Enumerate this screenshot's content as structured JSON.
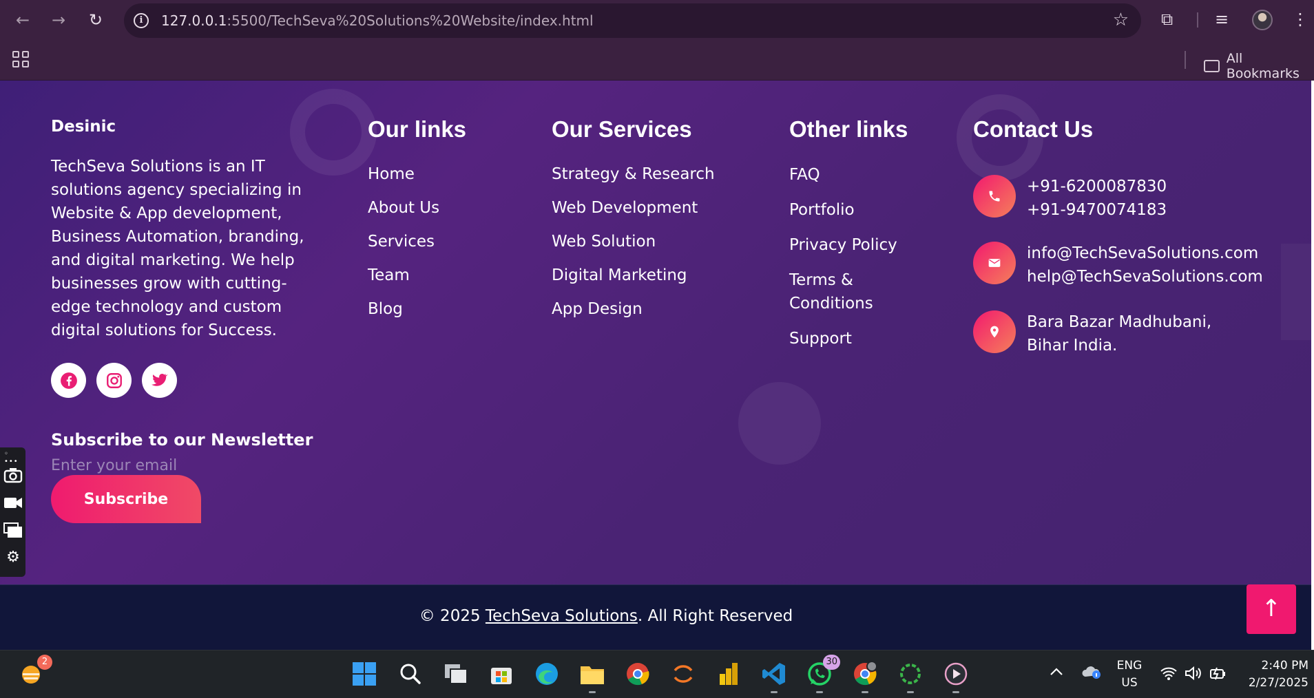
{
  "browser": {
    "url_host": "127.0.0.1",
    "url_rest": ":5500/TechSeva%20Solutions%20Website/index.html",
    "all_bookmarks": "All Bookmarks"
  },
  "footer": {
    "brand": "Desinic",
    "about": "TechSeva Solutions is an IT solutions agency specializing in Website & App development, Business Automation, branding, and digital marketing. We help businesses grow with cutting-edge technology and custom digital solutions for Success.",
    "socials": [
      "facebook",
      "instagram",
      "twitter"
    ],
    "newsletter": {
      "title": "Subscribe to our Newsletter",
      "placeholder": "Enter your email",
      "button": "Subscribe"
    },
    "our_links": {
      "title": "Our links",
      "items": [
        "Home",
        "About Us",
        "Services",
        "Team",
        "Blog"
      ]
    },
    "our_services": {
      "title": "Our Services",
      "items": [
        "Strategy & Research",
        "Web Development",
        "Web Solution",
        "Digital Marketing",
        "App Design"
      ]
    },
    "other_links": {
      "title": "Other links",
      "items": [
        "FAQ",
        "Portfolio",
        "Privacy Policy",
        "Terms & Conditions",
        "Support"
      ]
    },
    "contact": {
      "title": "Contact Us",
      "phone1": "+91-6200087830",
      "phone2": "+91-9470074183",
      "email1": "info@TechSevaSolutions.com",
      "email2": "help@TechSevaSolutions.com",
      "address": "Bara Bazar Madhubani, Bihar India."
    }
  },
  "copyright": {
    "prefix": "© 2025 ",
    "company": "TechSeva Solutions",
    "suffix": ". All Right Reserved"
  },
  "taskbar": {
    "weather_badge": "2",
    "whatsapp_badge": "30",
    "lang_line1": "ENG",
    "lang_line2": "US",
    "time": "2:40 PM",
    "date": "2/27/2025"
  },
  "colors": {
    "accent": "#f0196f",
    "footer_bg": "#4a2374",
    "copyright_bg": "#11163a"
  }
}
